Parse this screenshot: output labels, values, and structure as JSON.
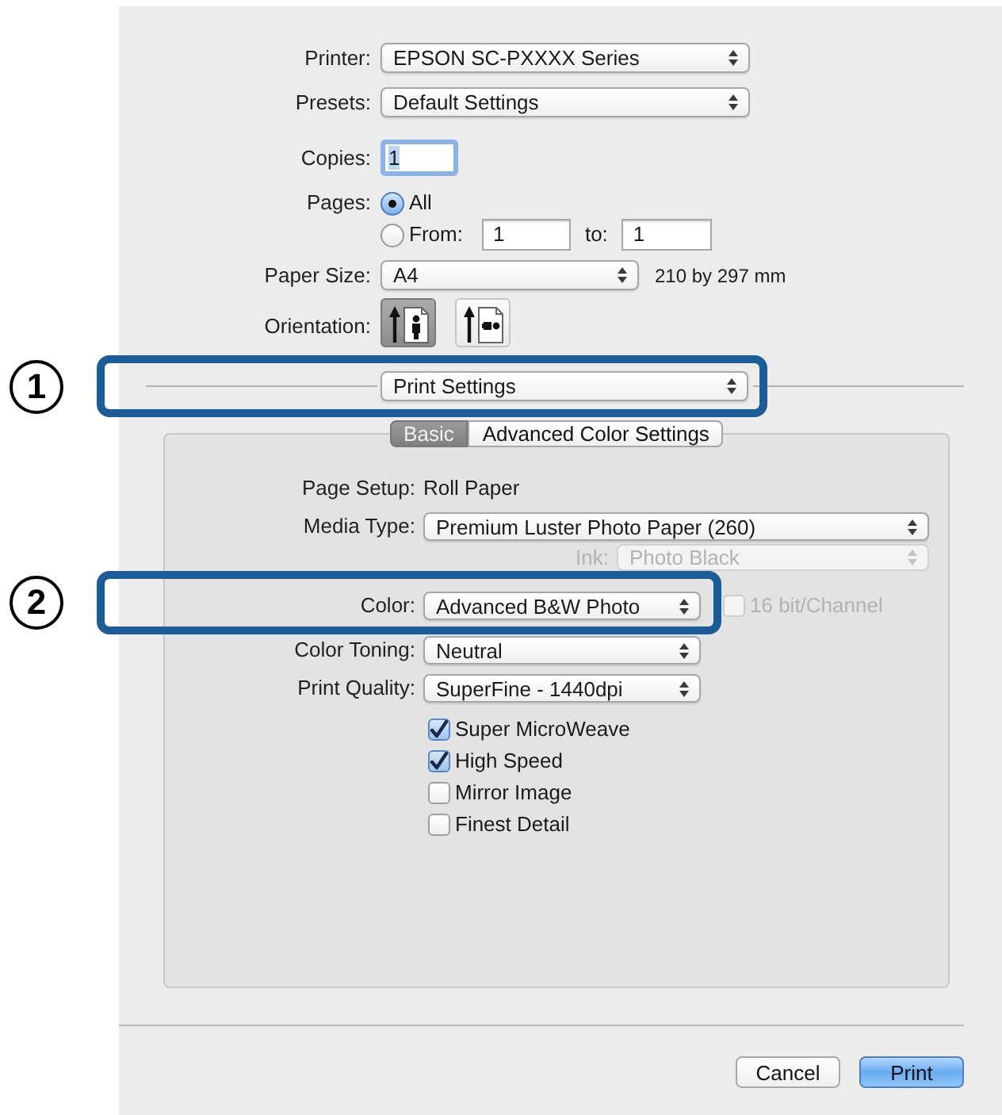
{
  "printer": {
    "label": "Printer:",
    "value": "EPSON SC-PXXXX Series"
  },
  "presets": {
    "label": "Presets:",
    "value": "Default Settings"
  },
  "copies": {
    "label": "Copies:",
    "value": "1",
    "focused": true
  },
  "pages": {
    "label": "Pages:",
    "options": [
      {
        "label": "All",
        "selected": true
      },
      {
        "label": "From:",
        "selected": false
      }
    ],
    "from": "1",
    "to_label": "to:",
    "to": "1"
  },
  "paper_size": {
    "label": "Paper Size:",
    "value": "A4",
    "dimensions": "210 by 297 mm"
  },
  "orientation": {
    "label": "Orientation:",
    "options": [
      {
        "kind": "portrait",
        "selected": true
      },
      {
        "kind": "landscape",
        "selected": false
      }
    ]
  },
  "section_menu": {
    "value": "Print Settings",
    "callout": "1"
  },
  "tabs": [
    {
      "label": "Basic",
      "selected": true
    },
    {
      "label": "Advanced Color Settings",
      "selected": false
    }
  ],
  "settings": [
    {
      "kind": "text",
      "label": "Page Setup:",
      "value": "Roll Paper"
    },
    {
      "kind": "popup",
      "label": "Media Type:",
      "value": "Premium Luster Photo Paper (260)",
      "disabled": false
    },
    {
      "kind": "popup",
      "label": "Ink:",
      "value": "Photo Black",
      "disabled": true
    },
    {
      "kind": "popup",
      "label": "Color:",
      "value": "Advanced B&W Photo",
      "disabled": false,
      "callout": "2",
      "option": {
        "label": "16 bit/Channel",
        "checked": false,
        "disabled": true
      }
    },
    {
      "kind": "popup",
      "label": "Color Toning:",
      "value": "Neutral",
      "disabled": false
    },
    {
      "kind": "popup",
      "label": "Print Quality:",
      "value": "SuperFine - 1440dpi",
      "disabled": false
    }
  ],
  "options": [
    {
      "label": "Super MicroWeave",
      "checked": true
    },
    {
      "label": "High Speed",
      "checked": true
    },
    {
      "label": "Mirror Image",
      "checked": false
    },
    {
      "label": "Finest Detail",
      "checked": false
    }
  ],
  "buttons": [
    {
      "label": "Cancel",
      "default": false
    },
    {
      "label": "Print",
      "default": true
    }
  ]
}
